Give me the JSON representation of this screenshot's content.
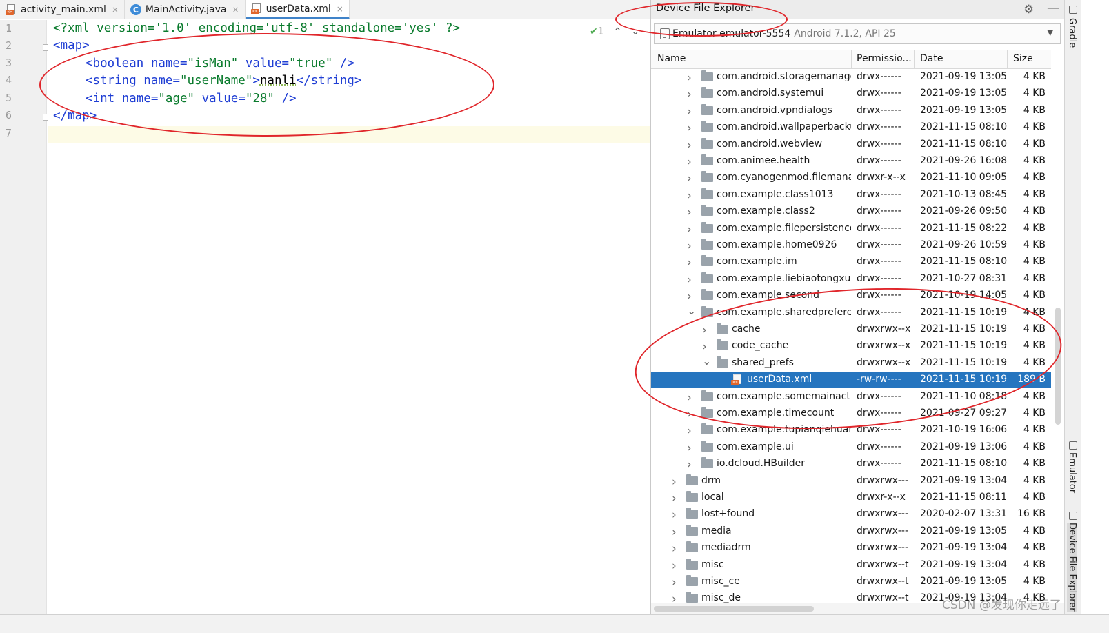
{
  "editor": {
    "tabs": [
      {
        "label": "activity_main.xml",
        "icon": "xml-file-icon",
        "active": false
      },
      {
        "label": "MainActivity.java",
        "icon": "java-class-icon",
        "active": false
      },
      {
        "label": "userData.xml",
        "icon": "xml-file-icon",
        "active": true
      }
    ],
    "close_glyph": "×",
    "line_numbers": [
      "1",
      "2",
      "3",
      "4",
      "5",
      "6",
      "7"
    ],
    "inspection_count": "1",
    "code": {
      "pi": "<?xml version='1.0' encoding='utf-8' standalone='yes' ?>",
      "map_open": "<map>",
      "bool_open": "<boolean ",
      "bool_attr_name": "name=",
      "bool_name_val": "\"isMan\"",
      "bool_attr_value": " value=",
      "bool_value_val": "\"true\"",
      "bool_close": " />",
      "str_open": "<string ",
      "str_attr_name": "name=",
      "str_name_val": "\"userName\"",
      "str_gt": ">",
      "str_text": "nanli",
      "str_close": "</string>",
      "int_open": "<int ",
      "int_attr_name": "name=",
      "int_name_val": "\"age\"",
      "int_attr_value": " value=",
      "int_value_val": "\"28\"",
      "int_close": " />",
      "map_close": "</map>"
    }
  },
  "device_explorer": {
    "title": "Device File Explorer",
    "gear_glyph": "⚙",
    "minimize_glyph": "—",
    "device_name": "Emulator emulator-5554",
    "device_detail": "Android 7.1.2, API 25",
    "columns": [
      "Name",
      "Permissio...",
      "Date",
      "Size"
    ],
    "rows": [
      {
        "name": "com.android.storagemanager",
        "perm": "drwx------",
        "date": "2021-09-19 13:05",
        "size": "4 KB",
        "indent": 2,
        "type": "folder",
        "expanded": false
      },
      {
        "name": "com.android.systemui",
        "perm": "drwx------",
        "date": "2021-09-19 13:05",
        "size": "4 KB",
        "indent": 2,
        "type": "folder",
        "expanded": false
      },
      {
        "name": "com.android.vpndialogs",
        "perm": "drwx------",
        "date": "2021-09-19 13:05",
        "size": "4 KB",
        "indent": 2,
        "type": "folder",
        "expanded": false
      },
      {
        "name": "com.android.wallpaperbackup",
        "perm": "drwx------",
        "date": "2021-11-15 08:10",
        "size": "4 KB",
        "indent": 2,
        "type": "folder",
        "expanded": false
      },
      {
        "name": "com.android.webview",
        "perm": "drwx------",
        "date": "2021-11-15 08:10",
        "size": "4 KB",
        "indent": 2,
        "type": "folder",
        "expanded": false
      },
      {
        "name": "com.animee.health",
        "perm": "drwx------",
        "date": "2021-09-26 16:08",
        "size": "4 KB",
        "indent": 2,
        "type": "folder",
        "expanded": false
      },
      {
        "name": "com.cyanogenmod.filemanager",
        "perm": "drwxr-x--x",
        "date": "2021-11-10 09:05",
        "size": "4 KB",
        "indent": 2,
        "type": "folder",
        "expanded": false
      },
      {
        "name": "com.example.class1013",
        "perm": "drwx------",
        "date": "2021-10-13 08:45",
        "size": "4 KB",
        "indent": 2,
        "type": "folder",
        "expanded": false
      },
      {
        "name": "com.example.class2",
        "perm": "drwx------",
        "date": "2021-09-26 09:50",
        "size": "4 KB",
        "indent": 2,
        "type": "folder",
        "expanded": false
      },
      {
        "name": "com.example.filepersistencetest",
        "perm": "drwx------",
        "date": "2021-11-15 08:22",
        "size": "4 KB",
        "indent": 2,
        "type": "folder",
        "expanded": false
      },
      {
        "name": "com.example.home0926",
        "perm": "drwx------",
        "date": "2021-09-26 10:59",
        "size": "4 KB",
        "indent": 2,
        "type": "folder",
        "expanded": false
      },
      {
        "name": "com.example.im",
        "perm": "drwx------",
        "date": "2021-11-15 08:10",
        "size": "4 KB",
        "indent": 2,
        "type": "folder",
        "expanded": false
      },
      {
        "name": "com.example.liebiaotongxunlu",
        "perm": "drwx------",
        "date": "2021-10-27 08:31",
        "size": "4 KB",
        "indent": 2,
        "type": "folder",
        "expanded": false
      },
      {
        "name": "com.example.second",
        "perm": "drwx------",
        "date": "2021-10-19 14:05",
        "size": "4 KB",
        "indent": 2,
        "type": "folder",
        "expanded": false
      },
      {
        "name": "com.example.sharedpreferences",
        "perm": "drwx------",
        "date": "2021-11-15 10:19",
        "size": "4 KB",
        "indent": 2,
        "type": "folder",
        "expanded": true
      },
      {
        "name": "cache",
        "perm": "drwxrwx--x",
        "date": "2021-11-15 10:19",
        "size": "4 KB",
        "indent": 3,
        "type": "folder",
        "expanded": false
      },
      {
        "name": "code_cache",
        "perm": "drwxrwx--x",
        "date": "2021-11-15 10:19",
        "size": "4 KB",
        "indent": 3,
        "type": "folder",
        "expanded": false
      },
      {
        "name": "shared_prefs",
        "perm": "drwxrwx--x",
        "date": "2021-11-15 10:19",
        "size": "4 KB",
        "indent": 3,
        "type": "folder",
        "expanded": true
      },
      {
        "name": "userData.xml",
        "perm": "-rw-rw----",
        "date": "2021-11-15 10:19",
        "size": "189 B",
        "indent": 4,
        "type": "xml",
        "selected": true
      },
      {
        "name": "com.example.somemainactivity",
        "perm": "drwx------",
        "date": "2021-11-10 08:18",
        "size": "4 KB",
        "indent": 2,
        "type": "folder",
        "expanded": false
      },
      {
        "name": "com.example.timecount",
        "perm": "drwx------",
        "date": "2021-09-27 09:27",
        "size": "4 KB",
        "indent": 2,
        "type": "folder",
        "expanded": false
      },
      {
        "name": "com.example.tupianqiehuan",
        "perm": "drwx------",
        "date": "2021-10-19 16:06",
        "size": "4 KB",
        "indent": 2,
        "type": "folder",
        "expanded": false
      },
      {
        "name": "com.example.ui",
        "perm": "drwx------",
        "date": "2021-09-19 13:06",
        "size": "4 KB",
        "indent": 2,
        "type": "folder",
        "expanded": false
      },
      {
        "name": "io.dcloud.HBuilder",
        "perm": "drwx------",
        "date": "2021-11-15 08:10",
        "size": "4 KB",
        "indent": 2,
        "type": "folder",
        "expanded": false
      },
      {
        "name": "drm",
        "perm": "drwxrwx---",
        "date": "2021-09-19 13:04",
        "size": "4 KB",
        "indent": 1,
        "type": "folder",
        "expanded": false
      },
      {
        "name": "local",
        "perm": "drwxr-x--x",
        "date": "2021-11-15 08:11",
        "size": "4 KB",
        "indent": 1,
        "type": "folder",
        "expanded": false
      },
      {
        "name": "lost+found",
        "perm": "drwxrwx---",
        "date": "2020-02-07 13:31",
        "size": "16 KB",
        "indent": 1,
        "type": "folder",
        "expanded": false
      },
      {
        "name": "media",
        "perm": "drwxrwx---",
        "date": "2021-09-19 13:05",
        "size": "4 KB",
        "indent": 1,
        "type": "folder",
        "expanded": false
      },
      {
        "name": "mediadrm",
        "perm": "drwxrwx---",
        "date": "2021-09-19 13:04",
        "size": "4 KB",
        "indent": 1,
        "type": "folder",
        "expanded": false
      },
      {
        "name": "misc",
        "perm": "drwxrwx--t",
        "date": "2021-09-19 13:04",
        "size": "4 KB",
        "indent": 1,
        "type": "folder",
        "expanded": false
      },
      {
        "name": "misc_ce",
        "perm": "drwxrwx--t",
        "date": "2021-09-19 13:05",
        "size": "4 KB",
        "indent": 1,
        "type": "folder",
        "expanded": false
      },
      {
        "name": "misc_de",
        "perm": "drwxrwx--t",
        "date": "2021-09-19 13:04",
        "size": "4 KB",
        "indent": 1,
        "type": "folder",
        "expanded": false
      }
    ]
  },
  "side_tools": {
    "gradle": "Gradle",
    "emulator": "Emulator",
    "device_file_explorer": "Device File Explorer"
  },
  "watermark": "CSDN @发现你走远了",
  "colors": {
    "selection": "#2675bf",
    "annotation": "#e0262b",
    "xml_tag": "#1f3ed4",
    "xml_value": "#0a7b2d"
  }
}
